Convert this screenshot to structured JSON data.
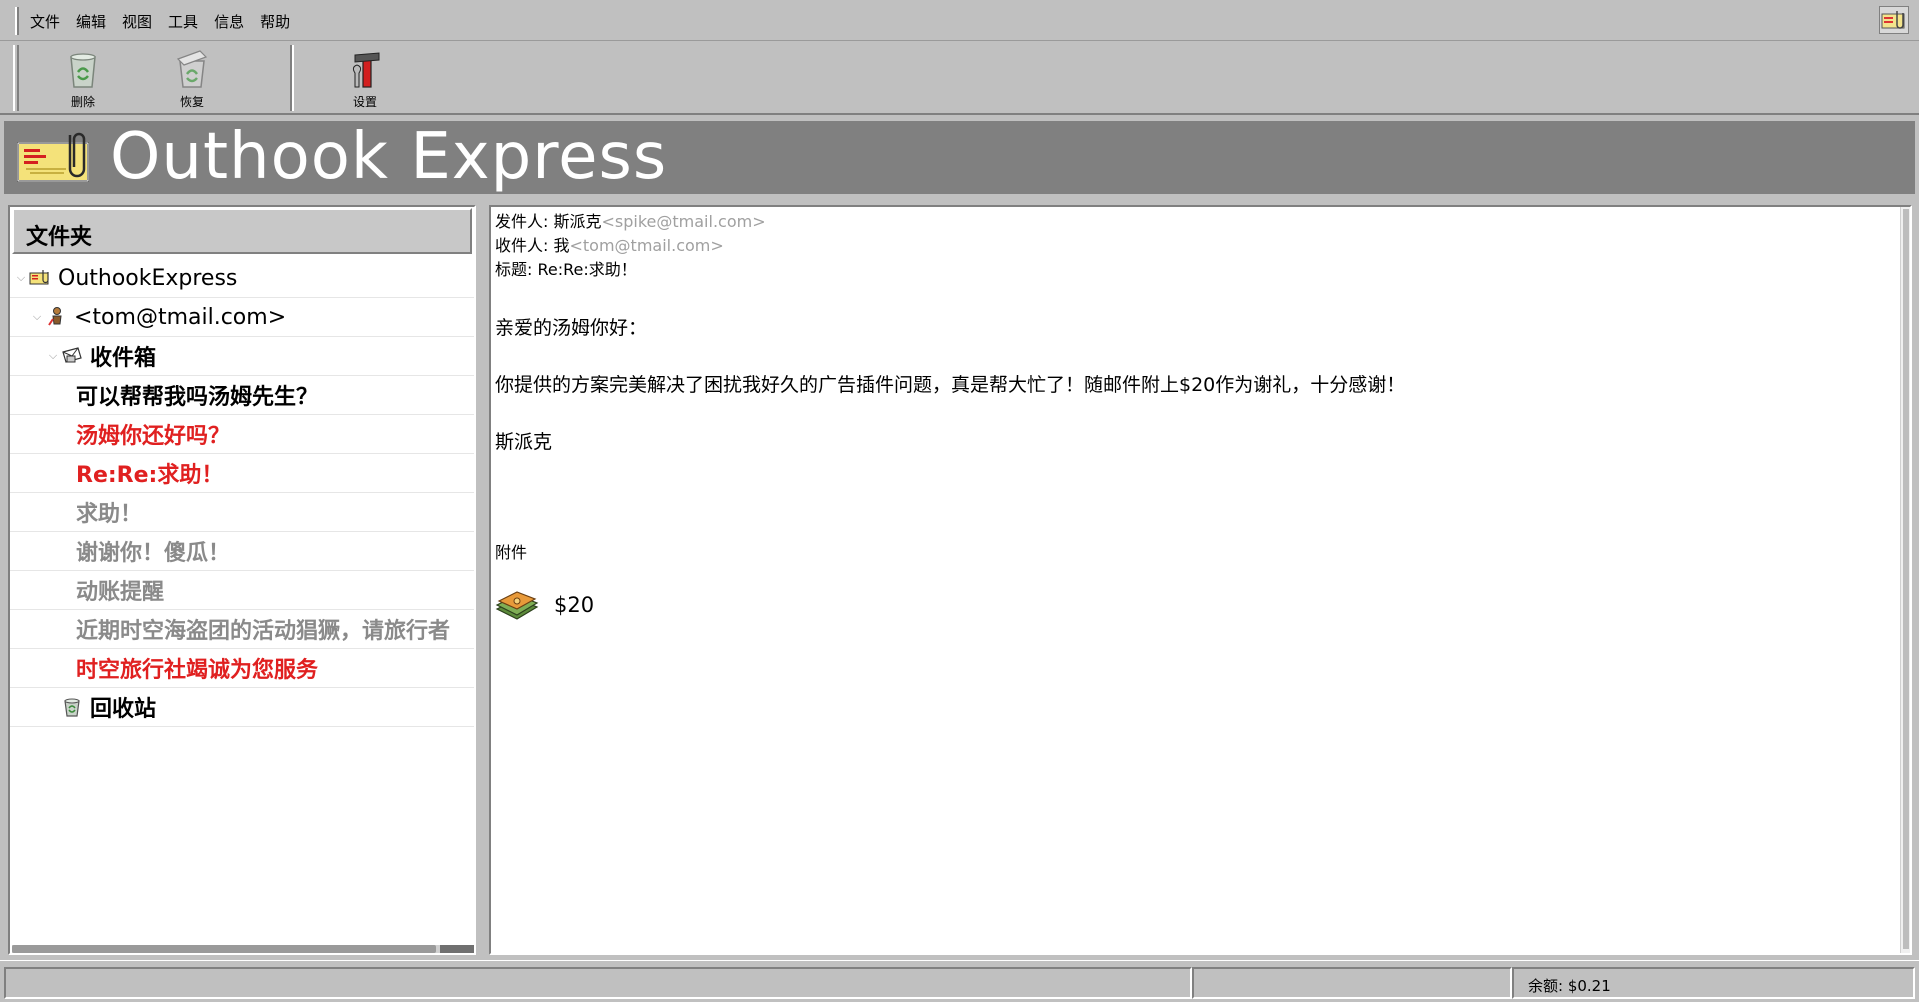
{
  "menu": {
    "items": [
      "文件",
      "编辑",
      "视图",
      "工具",
      "信息",
      "帮助"
    ]
  },
  "toolbar": {
    "delete_label": "删除",
    "restore_label": "恢复",
    "settings_label": "设置"
  },
  "banner": {
    "title": "Outhook Express"
  },
  "folders": {
    "header": "文件夹",
    "root": "OuthookExpress",
    "account": "<tom@tmail.com>",
    "inbox": "收件箱",
    "trash": "回收站",
    "messages": [
      {
        "subject": "可以帮帮我吗汤姆先生？",
        "state": "read-bold"
      },
      {
        "subject": "汤姆你还好吗？",
        "state": "unread"
      },
      {
        "subject": "Re:Re:求助！",
        "state": "unread"
      },
      {
        "subject": "求助！",
        "state": "read"
      },
      {
        "subject": "谢谢你！傻瓜！",
        "state": "read"
      },
      {
        "subject": "动账提醒",
        "state": "read"
      },
      {
        "subject": "近期时空海盗团的活动猖獗，请旅行者",
        "state": "read"
      },
      {
        "subject": "时空旅行社竭诚为您服务",
        "state": "unread"
      }
    ]
  },
  "message": {
    "from_label": "发件人: ",
    "from_name": "斯派克",
    "from_addr": "<spike@tmail.com>",
    "to_label": "收件人: ",
    "to_name": "我",
    "to_addr": "<tom@tmail.com>",
    "subject_label": "标题: ",
    "subject": "Re:Re:求助！",
    "greeting": "亲爱的汤姆你好：",
    "body": "你提供的方案完美解决了困扰我好久的广告插件问题，真是帮大忙了！随邮件附上$20作为谢礼，十分感谢！",
    "signature": "斯派克",
    "attachments_label": "附件",
    "attachment_name": "$20"
  },
  "status": {
    "balance": "余额: $0.21"
  },
  "colors": {
    "unread": "#e02020",
    "read": "#8a8a8a",
    "banner_bg": "#808080",
    "chrome": "#c0c0c0"
  }
}
